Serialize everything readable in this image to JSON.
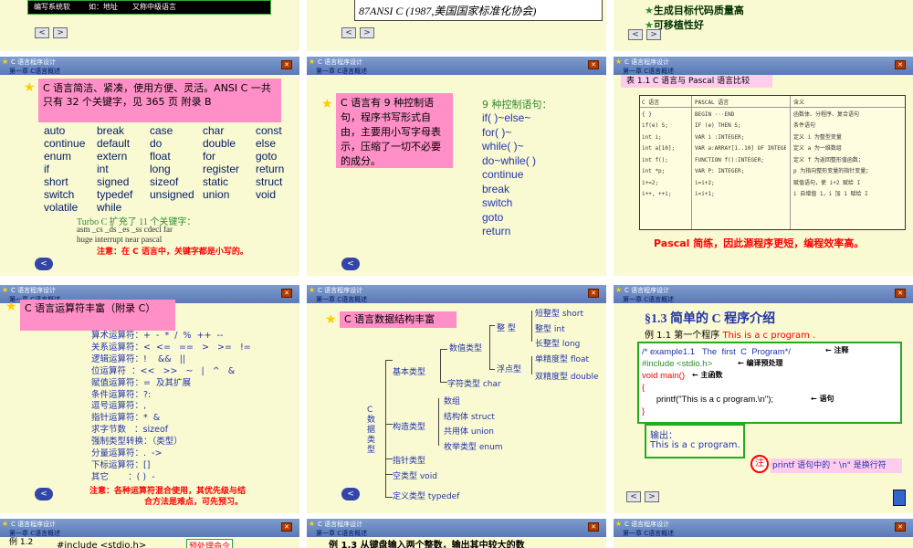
{
  "header": {
    "line1": "C 语言程序设计",
    "line2": "第一章  C语言概述"
  },
  "nav": {
    "prev": "<",
    "next": ">"
  },
  "s1": {
    "cell1": "编写系统软",
    "cell2": "如：地址",
    "cell3": "又称中级语言"
  },
  "s2": {
    "text": "87ANSI C (1987,美国国家标准化协会)"
  },
  "s3": {
    "item1": "生成目标代码质量高",
    "item2": "可移植性好"
  },
  "s4": {
    "box": "C 语言简洁、紧凑，使用方便、灵活。ANSI C 一共只有 32 个关键字，见 365 页 附录 B",
    "keywords": [
      "auto",
      "break",
      "case",
      "char",
      "const",
      "continue",
      "default",
      "do",
      "double",
      "else",
      "enum",
      "extern",
      "float",
      "for",
      "goto",
      "if",
      "int",
      "long",
      "register",
      "return",
      "short",
      "signed",
      "sizeof",
      "static",
      "struct",
      "switch",
      "typedef",
      "unsigned",
      "union",
      "void",
      "volatile",
      "while"
    ],
    "turbo": "Turbo C 扩充了 11 个关键字：",
    "turbo_row1": "asm    _cs    _ds    _es    _ss    cdecl   far",
    "turbo_row2": "huge   interrupt      near    pascal",
    "note": "注意：在 C 语言中，关键字都是小写的。"
  },
  "s5": {
    "box": "C 语言有 9 种控制语句，程序书写形式自由，主要用小写字母表示，压缩了一切不必要的成分。",
    "title": "9 种控制语句：",
    "items": [
      "if( )~else~",
      "for( )~",
      "while( )~",
      "do~while( )",
      "continue",
      "break",
      "switch",
      "goto",
      "return"
    ]
  },
  "s6": {
    "caption": "表 1.1  C 语言与 Pascal 语言比较",
    "col1": [
      "C 语言",
      "{   }",
      "if(e) S;",
      "int i;",
      "int a[10];",
      "",
      "int f();",
      "int *p;",
      "i+=2;",
      "i++, ++i;"
    ],
    "col2": [
      "PASCAL 语言",
      "BEGIN ···END",
      "IF (e) THEN  S;",
      "VAR i :INTEGER;",
      "VAR a:ARRAY[1..10] OF INTEGER;",
      "FUNCTION f():INTEGER;",
      "VAR  P: INTEGER;",
      "i=i+2;",
      "i=i+1;"
    ],
    "col3": [
      "含义",
      "函数体、分程序、复合语句",
      "条件语句",
      "定义 i 为整型变量",
      "定义 a 为一维数组",
      "定义 f 为返回整形值函数；",
      "p 为指向整形变量的指针变量；",
      "赋值语句，使 i+2 赋给 I",
      "i 自增值 1，i 加 1 赋给 I"
    ],
    "tail": "Pascal 简练，因此源程序更短，编程效率高。"
  },
  "s7": {
    "box": "C 语言运算符丰富（附录 C）",
    "ops": [
      "算术运算符：+  -  *  /  %  ++  --",
      "关系运算符：<  <=   ==   >   >=   !=",
      "逻辑运算符：!    &&   ||",
      "位运算符  ：<<   >>   ~   |   ^   &",
      "赋值运算符：=  及其扩展",
      "条件运算符：?:",
      "逗号运算符：,",
      "指针运算符：*  &",
      "求字节数   ：sizeof",
      "强制类型转换：（类型）",
      "分量运算符：.  ->",
      "下标运算符：[]",
      "其它       ：( )  -"
    ],
    "note1": "注意：各种运算符混合使用，其优先级与结",
    "note2": "合方法是难点，可先预习。"
  },
  "s8": {
    "box": "C 语言数据结构丰富",
    "root": "C\n数\n据\n类\n型",
    "basic": "基本类型",
    "numeric": "数值类型",
    "integer": "整    型",
    "float": "浮点型",
    "char": "字符类型 char",
    "short": "短整型 short",
    "int": "整型 int",
    "long": "长整型 long",
    "sfloat": "单精度型 float",
    "double": "双精度型 double",
    "construct": "构造类型",
    "array": "数组",
    "struct": "结构体 struct",
    "union": "共用体 union",
    "enum": "枚举类型 enum",
    "pointer": "指针类型",
    "void": "空类型 void",
    "typedef": "定义类型 typedef"
  },
  "s9": {
    "section": "§1.3  简单的 C 程序介绍",
    "example_label": "例 1.1   第一个程序 ",
    "example_red": "This is a c program .",
    "code": [
      "/* example1.1   The  first  C  Program*/",
      "#include <stdio.h>",
      "void main()",
      "{",
      "      printf(\"This is a c program.\\n\");",
      "}"
    ],
    "ann_comment": "注释",
    "ann_pre": "编译预处理",
    "ann_main": "主函数",
    "ann_stmt": "语句",
    "output_label": "输出：",
    "output_text": "This is a c program.",
    "note_circle": "注",
    "note_text": "printf 语句中的 \" \\n\" 是换行符"
  },
  "s10": {
    "label": "例 1.2",
    "code": "#include <stdio.h>",
    "ann": "预处理命令"
  },
  "s11": {
    "text": "例 1.3  从键盘输入两个整数，输出其中较大的数"
  }
}
